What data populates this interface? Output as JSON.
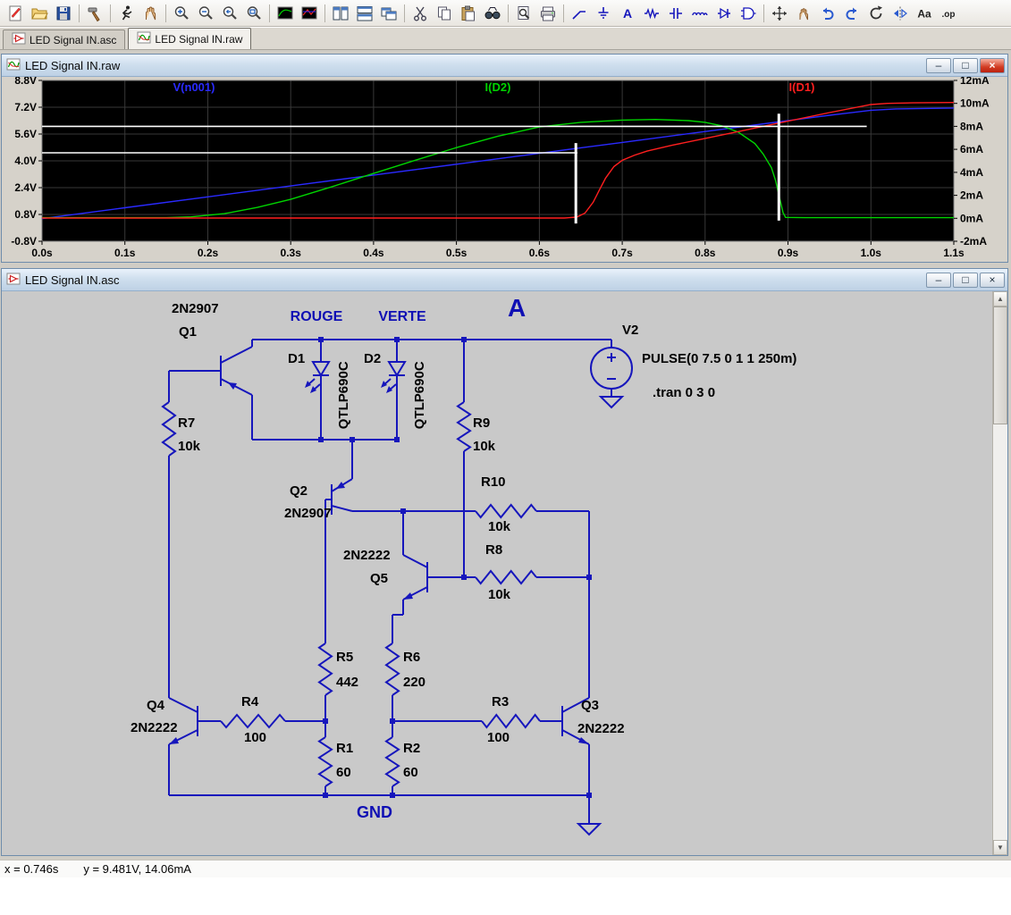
{
  "app": {
    "desktop_color": "#cfccc5"
  },
  "toolbar": {
    "items": [
      {
        "name": "new-schematic"
      },
      {
        "name": "open"
      },
      {
        "name": "save"
      },
      {
        "sep": true
      },
      {
        "name": "control-panel"
      },
      {
        "sep": true
      },
      {
        "name": "run"
      },
      {
        "name": "halt"
      },
      {
        "sep": true
      },
      {
        "name": "zoom-in"
      },
      {
        "name": "zoom-out"
      },
      {
        "name": "zoom-back"
      },
      {
        "name": "zoom-full"
      },
      {
        "sep": true
      },
      {
        "name": "autorange"
      },
      {
        "name": "plot-settings"
      },
      {
        "sep": true
      },
      {
        "name": "tile-vertical"
      },
      {
        "name": "tile-horizontal"
      },
      {
        "name": "cascade-windows"
      },
      {
        "sep": true
      },
      {
        "name": "cut"
      },
      {
        "name": "copy"
      },
      {
        "name": "paste"
      },
      {
        "name": "find"
      },
      {
        "sep": true
      },
      {
        "name": "print-preview"
      },
      {
        "name": "print"
      },
      {
        "sep": true
      },
      {
        "name": "wire"
      },
      {
        "name": "ground"
      },
      {
        "name": "net-label"
      },
      {
        "name": "resistor"
      },
      {
        "name": "capacitor"
      },
      {
        "name": "inductor"
      },
      {
        "name": "diode"
      },
      {
        "name": "component"
      },
      {
        "sep": true
      },
      {
        "name": "move"
      },
      {
        "name": "drag"
      },
      {
        "name": "undo"
      },
      {
        "name": "redo"
      },
      {
        "name": "rotate"
      },
      {
        "name": "mirror"
      },
      {
        "name": "text"
      },
      {
        "name": "spice-directive"
      }
    ]
  },
  "tabs": [
    {
      "label": "LED Signal IN.asc",
      "icon": "schematic-icon",
      "active": false
    },
    {
      "label": "LED Signal IN.raw",
      "icon": "waveform-icon",
      "active": true
    }
  ],
  "raw_window": {
    "title": "LED Signal IN.raw",
    "buttons": {
      "minimize": "–",
      "maximize": "□",
      "close": "×"
    }
  },
  "asc_window": {
    "title": "LED Signal IN.asc",
    "buttons": {
      "minimize": "–",
      "maximize": "□",
      "close": "×"
    }
  },
  "status_bar": {
    "cursor_x": "x = 0.746s",
    "cursor_y": "y = 9.481V, 14.06mA"
  },
  "chart_data": {
    "type": "line",
    "title": "LED Signal IN.raw",
    "background": "#000000",
    "grid_color": "#383838",
    "frame_color": "#7d7d7d",
    "axis_text_color": "#000000",
    "x_axis": {
      "unit": "s",
      "min": 0,
      "max": 1.1,
      "ticks": [
        0,
        0.1,
        0.2,
        0.3,
        0.4,
        0.5,
        0.6,
        0.7,
        0.8,
        0.9,
        1.0,
        1.1
      ],
      "tick_labels": [
        "0.0s",
        "0.1s",
        "0.2s",
        "0.3s",
        "0.4s",
        "0.5s",
        "0.6s",
        "0.7s",
        "0.8s",
        "0.9s",
        "1.0s",
        "1.1s"
      ]
    },
    "y_axis_left": {
      "unit": "V",
      "min": -0.8,
      "max": 8.8,
      "ticks": [
        8.8,
        7.2,
        5.6,
        4.0,
        2.4,
        0.8,
        -0.8
      ],
      "tick_labels": [
        "8.8V",
        "7.2V",
        "5.6V",
        "4.0V",
        "2.4V",
        "0.8V",
        "-0.8V"
      ]
    },
    "y_axis_right": {
      "unit": "mA",
      "min": -2,
      "max": 12,
      "ticks": [
        12,
        10,
        8,
        6,
        4,
        2,
        0,
        -2
      ],
      "tick_labels": [
        "12mA",
        "10mA",
        "8mA",
        "6mA",
        "4mA",
        "2mA",
        "0mA",
        "-2mA"
      ]
    },
    "series": [
      {
        "name": "V(n001)",
        "color": "#2a2aff",
        "axis": "left",
        "points": [
          [
            0,
            0.55
          ],
          [
            0.1,
            1.2
          ],
          [
            0.2,
            1.85
          ],
          [
            0.3,
            2.5
          ],
          [
            0.4,
            3.15
          ],
          [
            0.5,
            3.8
          ],
          [
            0.6,
            4.45
          ],
          [
            0.65,
            4.78
          ],
          [
            0.7,
            5.1
          ],
          [
            0.8,
            5.75
          ],
          [
            0.9,
            6.4
          ],
          [
            0.95,
            6.72
          ],
          [
            1.0,
            7.02
          ],
          [
            1.03,
            7.1
          ],
          [
            1.1,
            7.15
          ]
        ]
      },
      {
        "name": "I(D2)",
        "color": "#00d400",
        "axis": "right",
        "points": [
          [
            0,
            0.05
          ],
          [
            0.15,
            0.05
          ],
          [
            0.18,
            0.12
          ],
          [
            0.22,
            0.4
          ],
          [
            0.26,
            0.95
          ],
          [
            0.3,
            1.65
          ],
          [
            0.35,
            2.75
          ],
          [
            0.4,
            3.9
          ],
          [
            0.45,
            5.05
          ],
          [
            0.5,
            6.15
          ],
          [
            0.55,
            7.15
          ],
          [
            0.6,
            7.95
          ],
          [
            0.65,
            8.35
          ],
          [
            0.7,
            8.55
          ],
          [
            0.74,
            8.6
          ],
          [
            0.78,
            8.5
          ],
          [
            0.8,
            8.35
          ],
          [
            0.82,
            8.05
          ],
          [
            0.84,
            7.5
          ],
          [
            0.86,
            6.5
          ],
          [
            0.87,
            5.6
          ],
          [
            0.88,
            4.4
          ],
          [
            0.885,
            3.3
          ],
          [
            0.89,
            1.7
          ],
          [
            0.894,
            0.5
          ],
          [
            0.897,
            0.08
          ],
          [
            0.92,
            0.05
          ],
          [
            1.1,
            0.05
          ]
        ]
      },
      {
        "name": "I(D1)",
        "color": "#ff1f1f",
        "axis": "right",
        "points": [
          [
            0,
            0.02
          ],
          [
            0.63,
            0.02
          ],
          [
            0.645,
            0.1
          ],
          [
            0.655,
            0.45
          ],
          [
            0.665,
            1.4
          ],
          [
            0.672,
            2.4
          ],
          [
            0.68,
            3.5
          ],
          [
            0.69,
            4.5
          ],
          [
            0.7,
            5.05
          ],
          [
            0.715,
            5.5
          ],
          [
            0.73,
            5.85
          ],
          [
            0.76,
            6.35
          ],
          [
            0.8,
            6.95
          ],
          [
            0.85,
            7.7
          ],
          [
            0.9,
            8.45
          ],
          [
            0.95,
            9.2
          ],
          [
            1.0,
            9.9
          ],
          [
            1.02,
            10.0
          ],
          [
            1.05,
            10.05
          ],
          [
            1.1,
            10.08
          ]
        ]
      }
    ],
    "annotations": [
      {
        "type": "hline",
        "axis": "right",
        "y": 8.0,
        "t_from": 0,
        "t_to": 0.995,
        "color": "#ffffff"
      },
      {
        "type": "hline",
        "axis": "right",
        "y": 5.7,
        "t_from": 0,
        "t_to": 0.646,
        "color": "#ffffff"
      },
      {
        "type": "vline",
        "axis": "right",
        "t": 0.644,
        "y_from": -0.45,
        "y_to": 6.55,
        "color": "#ffffff"
      },
      {
        "type": "vline",
        "axis": "right",
        "t": 0.889,
        "y_from": -0.2,
        "y_to": 9.1,
        "color": "#ffffff"
      }
    ]
  },
  "schematic": {
    "wire_color": "#1616bc",
    "net_label_color": "#0f0fb4",
    "text_color": "#000000",
    "labels": {
      "q1_type": "2N2907",
      "q1_name": "Q1",
      "rouge": "ROUGE",
      "verte": "VERTE",
      "node_a": "A",
      "gnd": "GND",
      "d1_name": "D1",
      "d1_model": "QTLP690C",
      "d2_name": "D2",
      "d2_model": "QTLP690C",
      "v2_name": "V2",
      "v2_value": "PULSE(0 7.5 0 1 1 250m)",
      "tran_directive": ".tran 0 3 0",
      "r7_name": "R7",
      "r7_value": "10k",
      "r9_name": "R9",
      "r9_value": "10k",
      "r10_name": "R10",
      "r10_value": "10k",
      "r8_name": "R8",
      "r8_value": "10k",
      "q2_name": "Q2",
      "q2_type": "2N2907",
      "q5_name": "Q5",
      "q5_type": "2N2222",
      "r5_name": "R5",
      "r5_value": "442",
      "r6_name": "R6",
      "r6_value": "220",
      "r1_name": "R1",
      "r1_value": "60",
      "r2_name": "R2",
      "r2_value": "60",
      "r3_name": "R3",
      "r3_value": "100",
      "r4_name": "R4",
      "r4_value": "100",
      "q4_name": "Q4",
      "q4_type": "2N2222",
      "q3_name": "Q3",
      "q3_type": "2N2222"
    }
  }
}
